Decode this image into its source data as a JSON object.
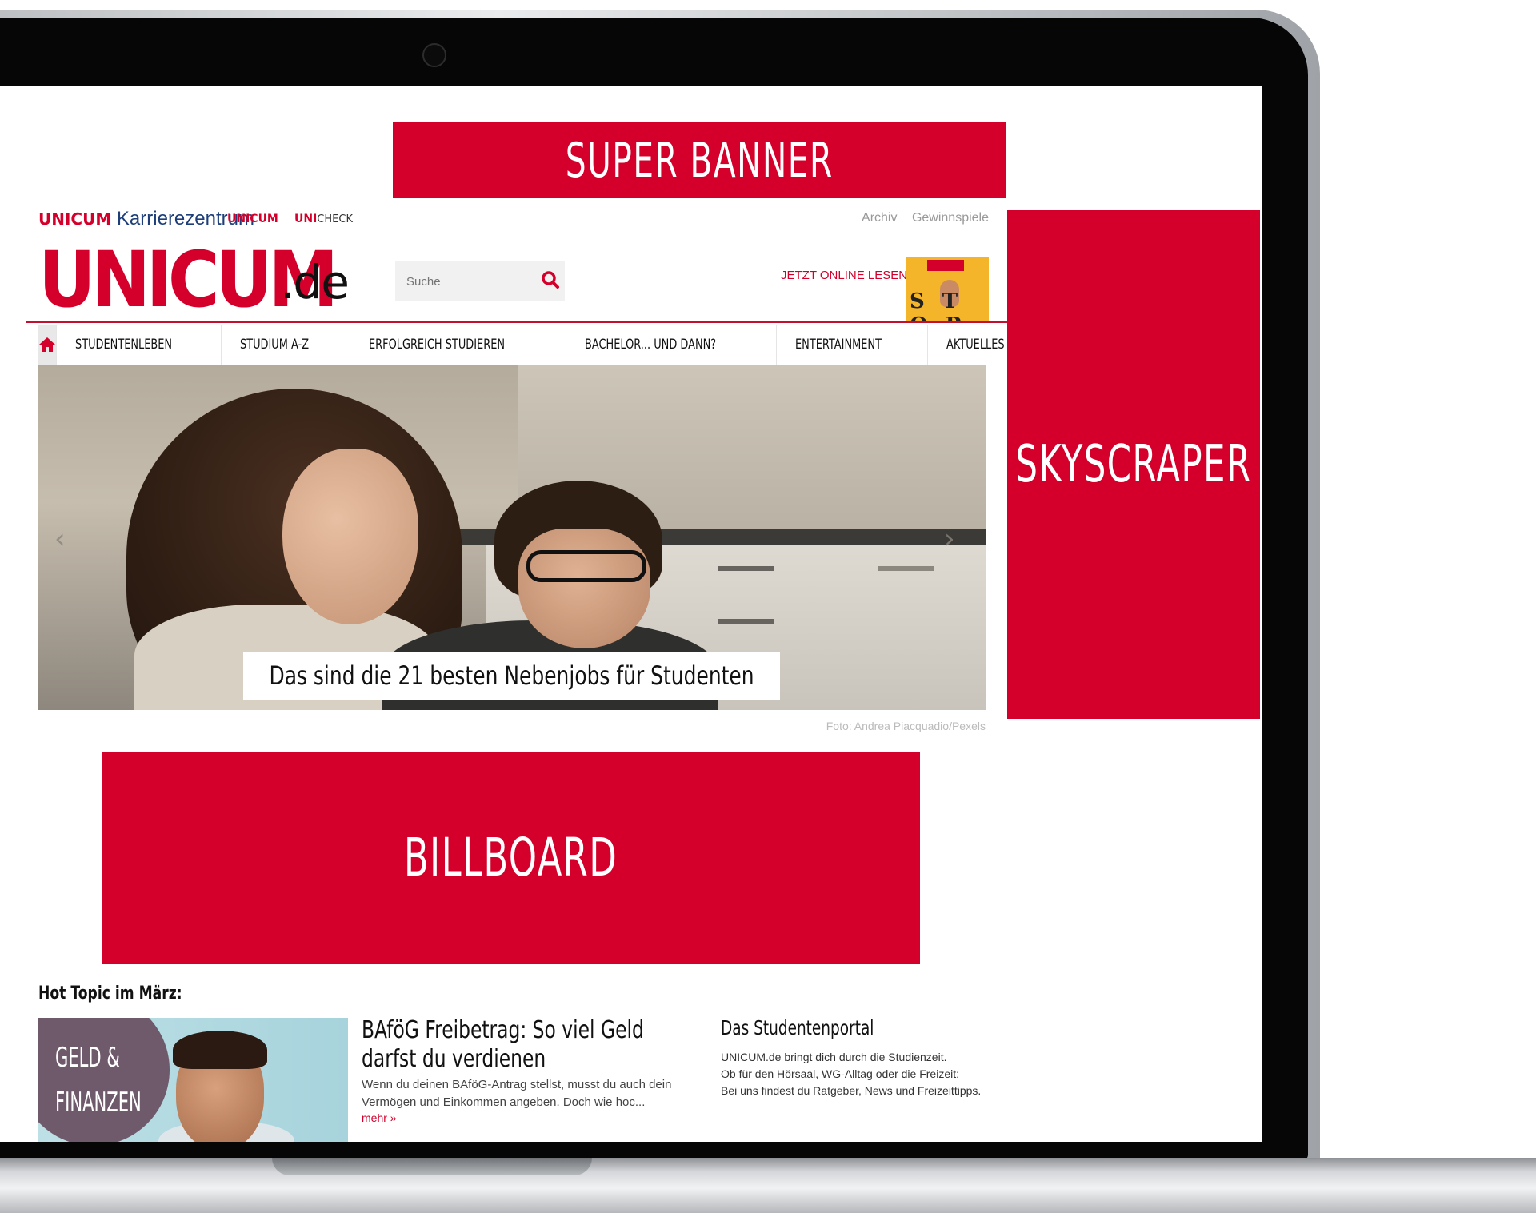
{
  "ads": {
    "super_banner": "SUPER BANNER",
    "skyscraper": "SKYSCRAPER",
    "billboard": "BILLBOARD"
  },
  "brand_row": {
    "main_red": "UNICUM",
    "main_blue": "Karrierezentrum",
    "abi": "UNICUM",
    "check_red": "UNI",
    "check_dark": "CHECK",
    "links": [
      "Archiv",
      "Gewinnspiele"
    ]
  },
  "header": {
    "logo_main": "UNICUM",
    "logo_suffix": ".de",
    "search_placeholder": "Suche",
    "online_label": "JETZT ONLINE LESEN:"
  },
  "nav": {
    "home_icon": "home-icon",
    "items": [
      "STUDENTENLEBEN",
      "STUDIUM A-Z",
      "ERFOLGREICH STUDIEREN",
      "BACHELOR... UND DANN?",
      "ENTERTAINMENT",
      "AKTUELLES"
    ]
  },
  "hero": {
    "caption": "Das sind die 21 besten Nebenjobs für Studenten",
    "photo_credit": "Foto: Andrea Piacquadio/Pexels",
    "prev_icon": "chevron-left-icon",
    "next_icon": "chevron-right-icon"
  },
  "hot_topic": {
    "heading": "Hot Topic im März:",
    "image_badge": "GELD &\nFINANZEN",
    "article_title": "BAföG Freibetrag: So viel Geld darfst du verdienen",
    "article_excerpt": "Wenn du deinen BAföG-Antrag stellst, musst du auch dein Vermögen und Einkommen angeben. Doch wie hoc...",
    "more_link": "mehr »"
  },
  "portal": {
    "title": "Das Studentenportal",
    "lines": [
      "UNICUM.de bringt dich durch die Studienzeit.",
      "Ob für den Hörsaal, WG-Alltag oder die Freizeit:",
      "Bei uns findest du Ratgeber, News und Freizeittipps."
    ]
  },
  "colors": {
    "accent_red": "#d4002b",
    "nav_rule": "#c4102e"
  }
}
